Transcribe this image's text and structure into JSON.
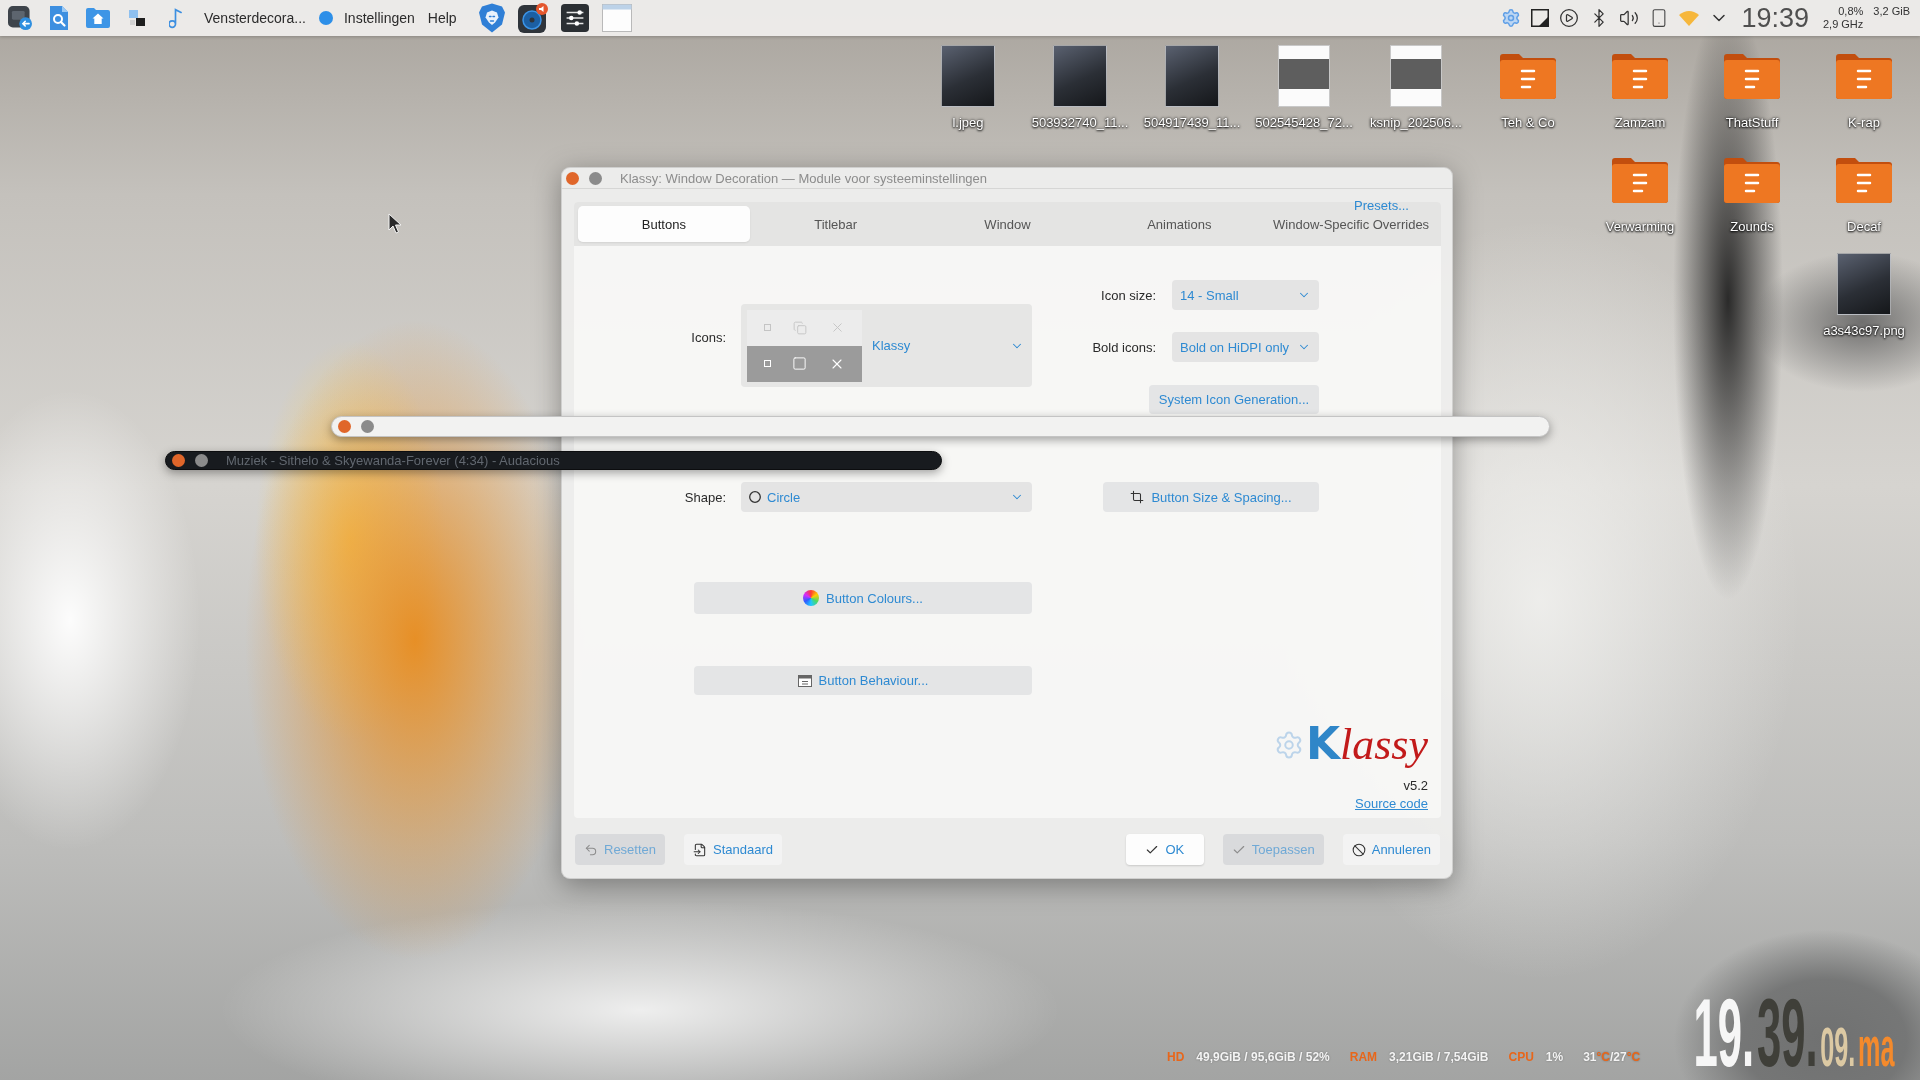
{
  "top_panel": {
    "task": "Vensterdecora...",
    "menu": [
      "Instellingen",
      "Help"
    ],
    "clock": "19:39",
    "stats": {
      "cpu": "0,8%",
      "memory": "3,2 GiB",
      "frequency": "2,9 GHz"
    }
  },
  "desktop_icons": [
    [
      {
        "label": "l.jpeg",
        "kind": "photo"
      },
      {
        "label": "503932740_11...",
        "kind": "photo"
      },
      {
        "label": "504917439_11...",
        "kind": "photo"
      },
      {
        "label": "502545428_72...",
        "kind": "document"
      },
      {
        "label": "ksnip_202506...",
        "kind": "document"
      },
      {
        "label": "Teh & Co",
        "kind": "folder"
      },
      {
        "label": "Zamzam",
        "kind": "folder"
      },
      {
        "label": "ThatStuff",
        "kind": "folder"
      },
      {
        "label": "K-rap",
        "kind": "folder"
      }
    ],
    [
      {
        "label": "Verwarming",
        "kind": "folder"
      },
      {
        "label": "Zounds",
        "kind": "folder"
      },
      {
        "label": "Decaf",
        "kind": "folder"
      }
    ],
    [
      {
        "label": "a3s43c97.png",
        "kind": "photo"
      }
    ]
  ],
  "dialog": {
    "title": "Klassy: Window Decoration — Module voor systeeminstellingen",
    "tabs": [
      {
        "label": "Buttons",
        "selected": true
      },
      {
        "label": "Titlebar",
        "selected": false
      },
      {
        "label": "Window",
        "selected": false
      },
      {
        "label": "Animations",
        "selected": false
      },
      {
        "label": "Window-Specific Overrides",
        "selected": false
      }
    ],
    "presets_link": "Presets...",
    "icons": {
      "label": "Icons:",
      "value": "Klassy"
    },
    "icon_size": {
      "label": "Icon size:",
      "value": "14 - Small"
    },
    "bold_icons": {
      "label": "Bold icons:",
      "value": "Bold on HiDPI only"
    },
    "system_icon_button": "System Icon Generation...",
    "shape": {
      "label": "Shape:",
      "value": "Circle"
    },
    "size_spacing_button": "Button Size & Spacing...",
    "colours_button": "Button Colours...",
    "behaviour_button": "Button Behaviour...",
    "logo": "Klassy",
    "version": "v5.2",
    "source_link": "Source code",
    "footer_buttons": [
      {
        "label": "Resetten",
        "kind": "reset",
        "disabled": true,
        "default": false
      },
      {
        "label": "Standaard",
        "kind": "defaults",
        "disabled": false,
        "default": false
      },
      {
        "label": "OK",
        "kind": "ok",
        "disabled": false,
        "default": true
      },
      {
        "label": "Toepassen",
        "kind": "apply",
        "disabled": true,
        "default": false
      },
      {
        "label": "Annuleren",
        "kind": "cancel",
        "disabled": false,
        "default": false
      }
    ]
  },
  "shaded_windows": [
    {
      "kind": "light"
    },
    {
      "kind": "dark",
      "title": "Muziek - Sithelo & Skyewanda-Forever (4:34) - Audacious"
    }
  ],
  "system_monitor": [
    {
      "label": "HD",
      "value": "49,9GiB / 95,6GiB / 52%"
    },
    {
      "label": "RAM",
      "value": "3,21GiB / 7,54GiB"
    },
    {
      "label": "CPU",
      "value": "1%"
    }
  ],
  "temperature": "31**°C**/27**°C**",
  "big_clock": [
    {
      "text": "19.",
      "kind": "hours"
    },
    {
      "text": "39.",
      "kind": "minutes"
    },
    {
      "text": "09.",
      "kind": "seconds"
    },
    {
      "text": "ma",
      "kind": "day"
    }
  ]
}
